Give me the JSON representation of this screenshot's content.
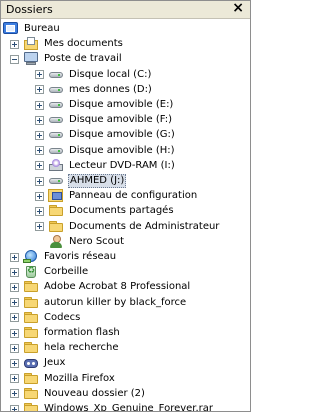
{
  "panel": {
    "title": "Dossiers",
    "close_glyph": "×"
  },
  "tree": [
    {
      "label": "Bureau",
      "icon": "desktop-icon",
      "expander": "none",
      "level": 0
    },
    {
      "label": "Mes documents",
      "icon": "my-documents-icon",
      "expander": "plus",
      "level": 1
    },
    {
      "label": "Poste de travail",
      "icon": "my-computer-icon",
      "expander": "minus",
      "level": 1
    },
    {
      "label": "Disque local (C:)",
      "icon": "hard-drive-icon",
      "expander": "plus",
      "level": 2
    },
    {
      "label": "mes donnes (D:)",
      "icon": "hard-drive-icon",
      "expander": "plus",
      "level": 2
    },
    {
      "label": "Disque amovible (E:)",
      "icon": "removable-drive-icon",
      "expander": "plus",
      "level": 2
    },
    {
      "label": "Disque amovible (F:)",
      "icon": "removable-drive-icon",
      "expander": "plus",
      "level": 2
    },
    {
      "label": "Disque amovible (G:)",
      "icon": "removable-drive-icon",
      "expander": "plus",
      "level": 2
    },
    {
      "label": "Disque amovible (H:)",
      "icon": "removable-drive-icon",
      "expander": "plus",
      "level": 2
    },
    {
      "label": "Lecteur DVD-RAM (I:)",
      "icon": "dvd-drive-icon",
      "expander": "plus",
      "level": 2
    },
    {
      "label": "AHMED (J:)",
      "icon": "removable-drive-icon",
      "expander": "plus",
      "level": 2,
      "selected": true
    },
    {
      "label": "Panneau de configuration",
      "icon": "control-panel-icon",
      "expander": "plus",
      "level": 2
    },
    {
      "label": "Documents partagés",
      "icon": "folder-icon",
      "expander": "plus",
      "level": 2
    },
    {
      "label": "Documents de Administrateur",
      "icon": "folder-icon",
      "expander": "plus",
      "level": 2
    },
    {
      "label": "Nero Scout",
      "icon": "user-icon",
      "expander": "none",
      "level": 2
    },
    {
      "label": "Favoris réseau",
      "icon": "network-icon",
      "expander": "plus",
      "level": 1
    },
    {
      "label": "Corbeille",
      "icon": "recycle-bin-icon",
      "expander": "plus",
      "level": 1
    },
    {
      "label": "Adobe Acrobat 8 Professional",
      "icon": "folder-icon",
      "expander": "plus",
      "level": 1
    },
    {
      "label": "autorun killer by black_force",
      "icon": "folder-icon",
      "expander": "plus",
      "level": 1
    },
    {
      "label": "Codecs",
      "icon": "folder-icon",
      "expander": "plus",
      "level": 1
    },
    {
      "label": "formation flash",
      "icon": "folder-icon",
      "expander": "plus",
      "level": 1
    },
    {
      "label": "hela recherche",
      "icon": "folder-icon",
      "expander": "plus",
      "level": 1
    },
    {
      "label": "Jeux",
      "icon": "games-icon",
      "expander": "plus",
      "level": 1
    },
    {
      "label": "Mozilla Firefox",
      "icon": "folder-icon",
      "expander": "plus",
      "level": 1
    },
    {
      "label": "Nouveau dossier (2)",
      "icon": "folder-icon",
      "expander": "plus",
      "level": 1
    },
    {
      "label": "Windows_Xp_Genuine_Forever.rar",
      "icon": "folder-icon",
      "expander": "plus",
      "level": 1
    }
  ]
}
